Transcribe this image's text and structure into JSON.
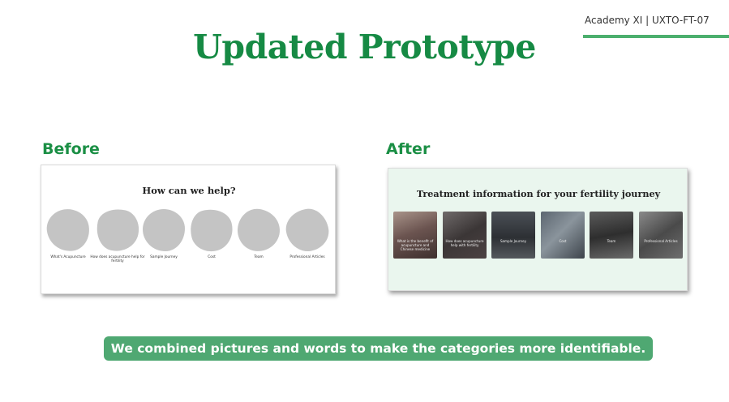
{
  "header": {
    "tag": "Academy XI | UXTO-FT-07",
    "title": "Updated Prototype"
  },
  "before": {
    "label": "Before",
    "heading": "How can we help?",
    "items": [
      "What's Acupuncture",
      "How does acupuncture help for fertility",
      "Sample Journey",
      "Cost",
      "Team",
      "Professional Articles"
    ]
  },
  "after": {
    "label": "After",
    "heading": "Treatment information for your fertility journey",
    "items": [
      "What is the benefit of acupuncture and Chinese medicine",
      "How does acupuncture help with fertility",
      "Sample Journey",
      "Cost",
      "Team",
      "Professional Articles"
    ]
  },
  "caption": "We combined pictures and words to make the categories more identifiable.",
  "colors": {
    "accent_green": "#168a44",
    "caption_bg": "#4fa872",
    "after_slide_bg": "#eaf6ee",
    "blob_gray": "#c4c4c4"
  }
}
